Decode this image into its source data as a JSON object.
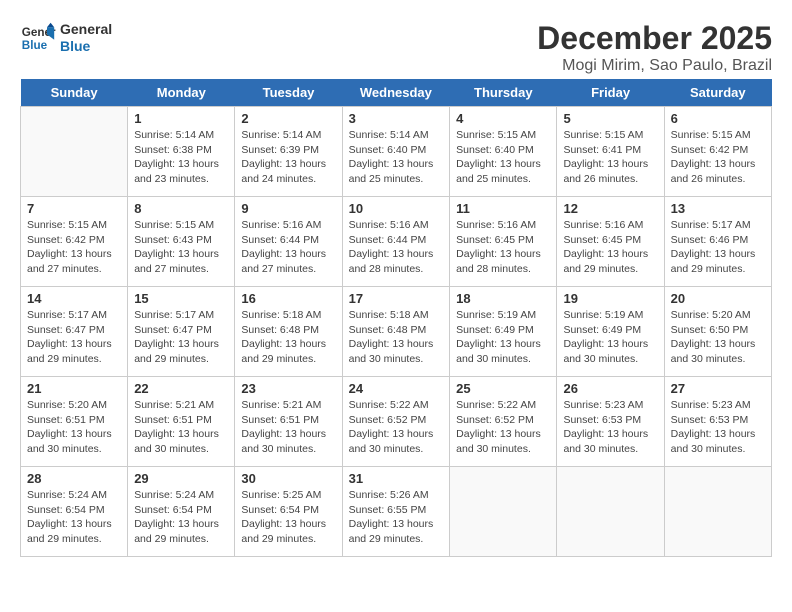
{
  "logo": {
    "line1": "General",
    "line2": "Blue"
  },
  "title": "December 2025",
  "location": "Mogi Mirim, Sao Paulo, Brazil",
  "headers": [
    "Sunday",
    "Monday",
    "Tuesday",
    "Wednesday",
    "Thursday",
    "Friday",
    "Saturday"
  ],
  "weeks": [
    [
      {
        "day": "",
        "sunrise": "",
        "sunset": "",
        "daylight": ""
      },
      {
        "day": "1",
        "sunrise": "Sunrise: 5:14 AM",
        "sunset": "Sunset: 6:38 PM",
        "daylight": "Daylight: 13 hours and 23 minutes."
      },
      {
        "day": "2",
        "sunrise": "Sunrise: 5:14 AM",
        "sunset": "Sunset: 6:39 PM",
        "daylight": "Daylight: 13 hours and 24 minutes."
      },
      {
        "day": "3",
        "sunrise": "Sunrise: 5:14 AM",
        "sunset": "Sunset: 6:40 PM",
        "daylight": "Daylight: 13 hours and 25 minutes."
      },
      {
        "day": "4",
        "sunrise": "Sunrise: 5:15 AM",
        "sunset": "Sunset: 6:40 PM",
        "daylight": "Daylight: 13 hours and 25 minutes."
      },
      {
        "day": "5",
        "sunrise": "Sunrise: 5:15 AM",
        "sunset": "Sunset: 6:41 PM",
        "daylight": "Daylight: 13 hours and 26 minutes."
      },
      {
        "day": "6",
        "sunrise": "Sunrise: 5:15 AM",
        "sunset": "Sunset: 6:42 PM",
        "daylight": "Daylight: 13 hours and 26 minutes."
      }
    ],
    [
      {
        "day": "7",
        "sunrise": "Sunrise: 5:15 AM",
        "sunset": "Sunset: 6:42 PM",
        "daylight": "Daylight: 13 hours and 27 minutes."
      },
      {
        "day": "8",
        "sunrise": "Sunrise: 5:15 AM",
        "sunset": "Sunset: 6:43 PM",
        "daylight": "Daylight: 13 hours and 27 minutes."
      },
      {
        "day": "9",
        "sunrise": "Sunrise: 5:16 AM",
        "sunset": "Sunset: 6:44 PM",
        "daylight": "Daylight: 13 hours and 27 minutes."
      },
      {
        "day": "10",
        "sunrise": "Sunrise: 5:16 AM",
        "sunset": "Sunset: 6:44 PM",
        "daylight": "Daylight: 13 hours and 28 minutes."
      },
      {
        "day": "11",
        "sunrise": "Sunrise: 5:16 AM",
        "sunset": "Sunset: 6:45 PM",
        "daylight": "Daylight: 13 hours and 28 minutes."
      },
      {
        "day": "12",
        "sunrise": "Sunrise: 5:16 AM",
        "sunset": "Sunset: 6:45 PM",
        "daylight": "Daylight: 13 hours and 29 minutes."
      },
      {
        "day": "13",
        "sunrise": "Sunrise: 5:17 AM",
        "sunset": "Sunset: 6:46 PM",
        "daylight": "Daylight: 13 hours and 29 minutes."
      }
    ],
    [
      {
        "day": "14",
        "sunrise": "Sunrise: 5:17 AM",
        "sunset": "Sunset: 6:47 PM",
        "daylight": "Daylight: 13 hours and 29 minutes."
      },
      {
        "day": "15",
        "sunrise": "Sunrise: 5:17 AM",
        "sunset": "Sunset: 6:47 PM",
        "daylight": "Daylight: 13 hours and 29 minutes."
      },
      {
        "day": "16",
        "sunrise": "Sunrise: 5:18 AM",
        "sunset": "Sunset: 6:48 PM",
        "daylight": "Daylight: 13 hours and 29 minutes."
      },
      {
        "day": "17",
        "sunrise": "Sunrise: 5:18 AM",
        "sunset": "Sunset: 6:48 PM",
        "daylight": "Daylight: 13 hours and 30 minutes."
      },
      {
        "day": "18",
        "sunrise": "Sunrise: 5:19 AM",
        "sunset": "Sunset: 6:49 PM",
        "daylight": "Daylight: 13 hours and 30 minutes."
      },
      {
        "day": "19",
        "sunrise": "Sunrise: 5:19 AM",
        "sunset": "Sunset: 6:49 PM",
        "daylight": "Daylight: 13 hours and 30 minutes."
      },
      {
        "day": "20",
        "sunrise": "Sunrise: 5:20 AM",
        "sunset": "Sunset: 6:50 PM",
        "daylight": "Daylight: 13 hours and 30 minutes."
      }
    ],
    [
      {
        "day": "21",
        "sunrise": "Sunrise: 5:20 AM",
        "sunset": "Sunset: 6:51 PM",
        "daylight": "Daylight: 13 hours and 30 minutes."
      },
      {
        "day": "22",
        "sunrise": "Sunrise: 5:21 AM",
        "sunset": "Sunset: 6:51 PM",
        "daylight": "Daylight: 13 hours and 30 minutes."
      },
      {
        "day": "23",
        "sunrise": "Sunrise: 5:21 AM",
        "sunset": "Sunset: 6:51 PM",
        "daylight": "Daylight: 13 hours and 30 minutes."
      },
      {
        "day": "24",
        "sunrise": "Sunrise: 5:22 AM",
        "sunset": "Sunset: 6:52 PM",
        "daylight": "Daylight: 13 hours and 30 minutes."
      },
      {
        "day": "25",
        "sunrise": "Sunrise: 5:22 AM",
        "sunset": "Sunset: 6:52 PM",
        "daylight": "Daylight: 13 hours and 30 minutes."
      },
      {
        "day": "26",
        "sunrise": "Sunrise: 5:23 AM",
        "sunset": "Sunset: 6:53 PM",
        "daylight": "Daylight: 13 hours and 30 minutes."
      },
      {
        "day": "27",
        "sunrise": "Sunrise: 5:23 AM",
        "sunset": "Sunset: 6:53 PM",
        "daylight": "Daylight: 13 hours and 30 minutes."
      }
    ],
    [
      {
        "day": "28",
        "sunrise": "Sunrise: 5:24 AM",
        "sunset": "Sunset: 6:54 PM",
        "daylight": "Daylight: 13 hours and 29 minutes."
      },
      {
        "day": "29",
        "sunrise": "Sunrise: 5:24 AM",
        "sunset": "Sunset: 6:54 PM",
        "daylight": "Daylight: 13 hours and 29 minutes."
      },
      {
        "day": "30",
        "sunrise": "Sunrise: 5:25 AM",
        "sunset": "Sunset: 6:54 PM",
        "daylight": "Daylight: 13 hours and 29 minutes."
      },
      {
        "day": "31",
        "sunrise": "Sunrise: 5:26 AM",
        "sunset": "Sunset: 6:55 PM",
        "daylight": "Daylight: 13 hours and 29 minutes."
      },
      {
        "day": "",
        "sunrise": "",
        "sunset": "",
        "daylight": ""
      },
      {
        "day": "",
        "sunrise": "",
        "sunset": "",
        "daylight": ""
      },
      {
        "day": "",
        "sunrise": "",
        "sunset": "",
        "daylight": ""
      }
    ]
  ]
}
